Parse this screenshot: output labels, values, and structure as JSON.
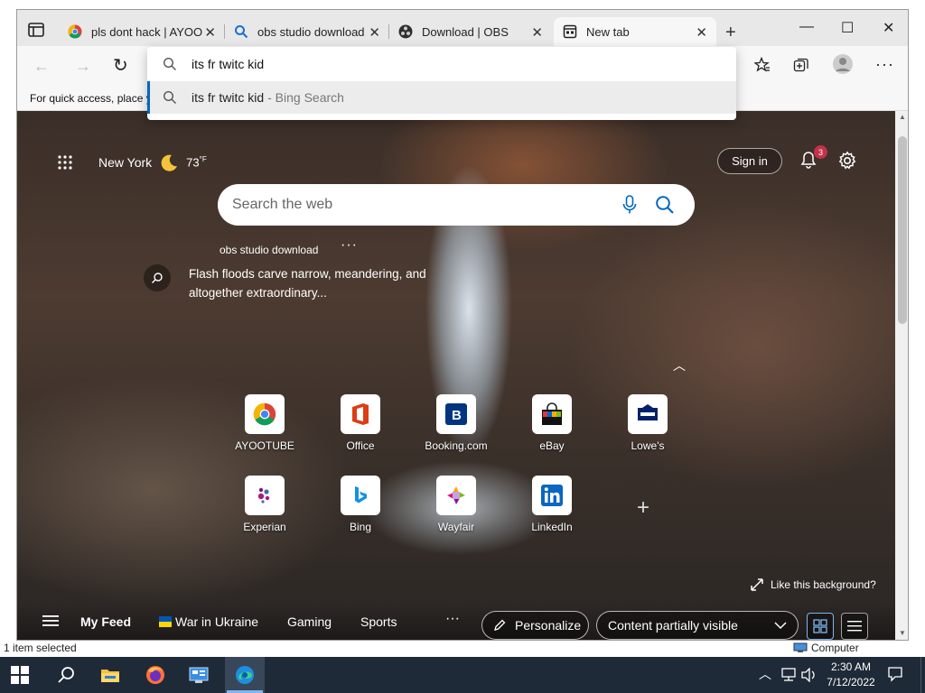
{
  "background_window": {
    "status_left": "1 item selected",
    "status_right": "Computer"
  },
  "tabs": [
    {
      "label": "pls dont hack | AYOO",
      "icon": "chrome-icon"
    },
    {
      "label": "obs studio download",
      "icon": "search-icon"
    },
    {
      "label": "Download | OBS",
      "icon": "obs-icon"
    },
    {
      "label": "New tab",
      "icon": "newtab-icon",
      "active": true
    }
  ],
  "favorites_bar": {
    "text": "For quick access, place y"
  },
  "omnibox": {
    "typed": "its fr twitc kid",
    "suggestion_query": "its fr twitc kid",
    "suggestion_suffix": "- Bing Search"
  },
  "ntp": {
    "city": "New York",
    "temperature": "73",
    "temp_unit": "°F",
    "signin_label": "Sign in",
    "notification_count": "3",
    "search_placeholder": "Search the web",
    "trending": "obs studio download",
    "fact": "Flash floods carve narrow, meandering, and altogether extraordinary...",
    "tiles": [
      {
        "label": "AYOOTUBE"
      },
      {
        "label": "Office"
      },
      {
        "label": "Booking.com"
      },
      {
        "label": "eBay"
      },
      {
        "label": "Lowe's"
      },
      {
        "label": "Experian"
      },
      {
        "label": "Bing"
      },
      {
        "label": "Wayfair"
      },
      {
        "label": "LinkedIn"
      }
    ],
    "like_background": "Like this background?",
    "feed": {
      "my_feed": "My Feed",
      "war": "War in Ukraine",
      "gaming": "Gaming",
      "sports": "Sports",
      "personalize": "Personalize",
      "content_visibility": "Content partially visible"
    }
  },
  "taskbar": {
    "time": "2:30 AM",
    "date": "7/12/2022"
  },
  "colors": {
    "accent": "#0067c0",
    "badge": "#c4314b",
    "taskbar": "#1f2a38"
  }
}
